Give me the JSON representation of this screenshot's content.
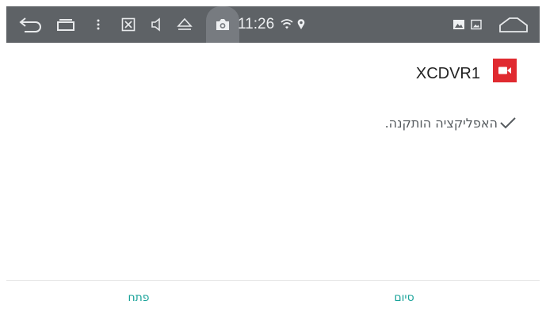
{
  "status_bar": {
    "time": "11:26",
    "icons": [
      "back-icon",
      "recent-apps-icon",
      "menu-dots-icon",
      "screenshot-icon",
      "volume-icon",
      "eject-icon",
      "camera-icon",
      "wifi-icon",
      "location-icon",
      "gallery-icon",
      "image-icon",
      "home-icon"
    ],
    "background": "#5e6266"
  },
  "app": {
    "name": "XCDVR1",
    "icon": "video-camera-icon",
    "icon_color": "#e02a30"
  },
  "message": {
    "text": "האפליקציה הותקנה."
  },
  "footer": {
    "open_label": "פתח",
    "done_label": "סיום",
    "accent_color": "#1aa39a"
  }
}
